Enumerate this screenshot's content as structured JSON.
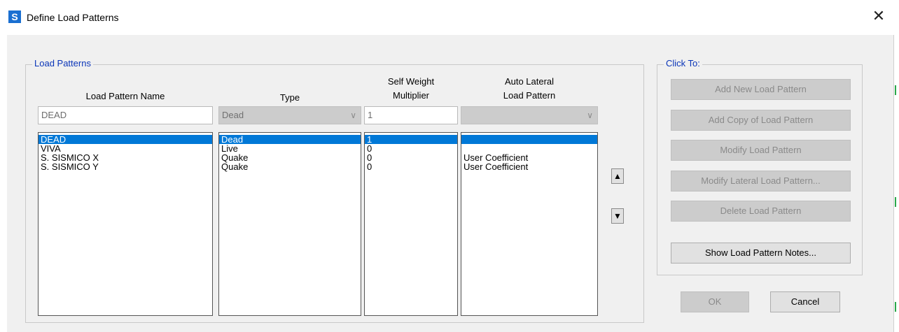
{
  "window": {
    "app_icon_letter": "S",
    "title": "Define Load Patterns",
    "close_glyph": "✕"
  },
  "load_patterns_group": {
    "legend": "Load Patterns",
    "headers": {
      "name": "Load Pattern Name",
      "type": "Type",
      "multiplier_line1": "Self Weight",
      "multiplier_line2": "Multiplier",
      "lateral_line1": "Auto Lateral",
      "lateral_line2": "Load Pattern"
    },
    "edit_row": {
      "name": "DEAD",
      "type": "Dead",
      "multiplier": "1",
      "lateral": ""
    },
    "chevron_glyph": "∨",
    "rows": [
      {
        "name": "DEAD",
        "type": "Dead",
        "multiplier": "1",
        "lateral": ""
      },
      {
        "name": "VIVA",
        "type": "Live",
        "multiplier": "0",
        "lateral": ""
      },
      {
        "name": "S. SISMICO X",
        "type": "Quake",
        "multiplier": "0",
        "lateral": "User Coefficient"
      },
      {
        "name": "S. SISMICO Y",
        "type": "Quake",
        "multiplier": "0",
        "lateral": "User Coefficient"
      }
    ],
    "selected_row": 0,
    "move_up_glyph": "▲",
    "move_down_glyph": "▼"
  },
  "click_to_group": {
    "legend": "Click To:",
    "buttons": [
      {
        "label": "Add New Load Pattern",
        "enabled": false
      },
      {
        "label": "Add Copy of Load Pattern",
        "enabled": false
      },
      {
        "label": "Modify Load Pattern",
        "enabled": false
      },
      {
        "label": "Modify Lateral Load Pattern...",
        "enabled": false
      },
      {
        "label": "Delete Load Pattern",
        "enabled": false
      },
      {
        "label": "Show Load Pattern Notes...",
        "enabled": true
      }
    ]
  },
  "footer": {
    "ok_label": "OK",
    "cancel_label": "Cancel"
  },
  "colors": {
    "selection": "#0078d7",
    "group_legend": "#0a35b8",
    "dialog_bg": "#f0f0f0",
    "disabled_bg": "#cccccc"
  }
}
